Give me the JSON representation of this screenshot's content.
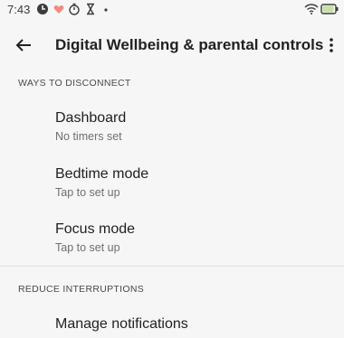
{
  "status_bar": {
    "time": "7:43",
    "icons": [
      "data-saver-icon",
      "heart-icon",
      "timer-icon",
      "hourglass-icon",
      "dot-icon"
    ],
    "right_icons": [
      "wifi-icon",
      "battery-icon"
    ]
  },
  "app_bar": {
    "title": "Digital Wellbeing & parental controls"
  },
  "sections": [
    {
      "header": "WAYS TO DISCONNECT",
      "items": [
        {
          "title": "Dashboard",
          "subtitle": "No timers set"
        },
        {
          "title": "Bedtime mode",
          "subtitle": "Tap to set up"
        },
        {
          "title": "Focus mode",
          "subtitle": "Tap to set up"
        }
      ]
    },
    {
      "header": "REDUCE INTERRUPTIONS",
      "items": [
        {
          "title": "Manage notifications"
        }
      ]
    }
  ],
  "colors": {
    "background": "#f6f6f6",
    "heart": "#f28b82",
    "battery": "#c5e1a5"
  }
}
